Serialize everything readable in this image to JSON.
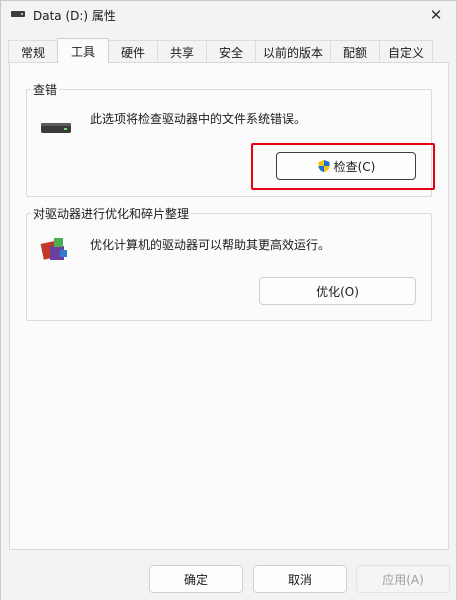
{
  "window": {
    "title": "Data (D:) 属性",
    "close_symbol": "✕"
  },
  "tabs": [
    {
      "label": "常规"
    },
    {
      "label": "工具",
      "active": true
    },
    {
      "label": "硬件"
    },
    {
      "label": "共享"
    },
    {
      "label": "安全"
    },
    {
      "label": "以前的版本"
    },
    {
      "label": "配额"
    },
    {
      "label": "自定义"
    }
  ],
  "check_group": {
    "title": "查错",
    "description": "此选项将检查驱动器中的文件系统错误。",
    "button_label": "检查(C)",
    "icon": "drive-icon",
    "button_icon": "uac-shield-icon",
    "highlight_color": "#e60012"
  },
  "optimize_group": {
    "title": "对驱动器进行优化和碎片整理",
    "description": "优化计算机的驱动器可以帮助其更高效运行。",
    "button_label": "优化(O)",
    "icon": "defrag-icon"
  },
  "footer": {
    "ok_label": "确定",
    "cancel_label": "取消",
    "apply_label": "应用(A)"
  }
}
